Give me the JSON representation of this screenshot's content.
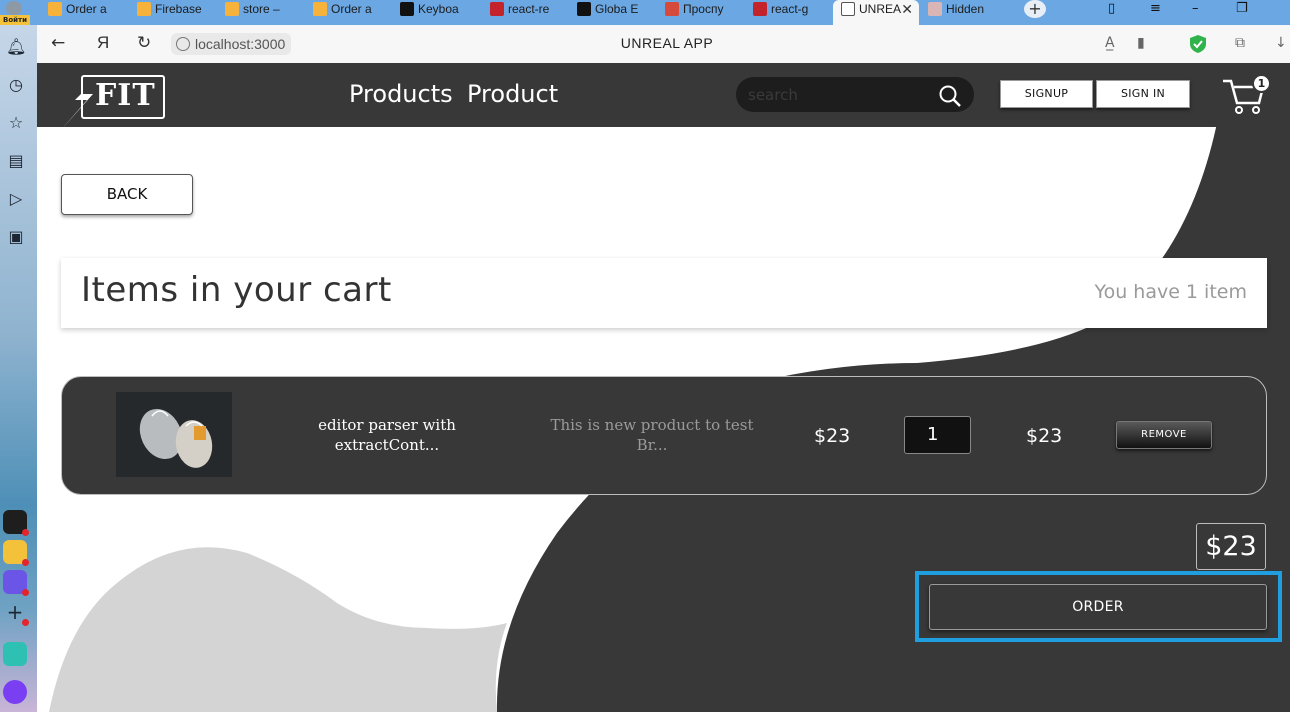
{
  "browser": {
    "profile_label": "Войти",
    "tabs": [
      {
        "label": "Order a",
        "color": "#f6b23b"
      },
      {
        "label": "Firebase",
        "color": "#f6b23b"
      },
      {
        "label": "store – ",
        "color": "#f6b23b"
      },
      {
        "label": "Order a",
        "color": "#f6b23b"
      },
      {
        "label": "Keyboa",
        "color": "#111111"
      },
      {
        "label": "react-re",
        "color": "#c3242b"
      },
      {
        "label": "Globa E",
        "color": "#111111"
      },
      {
        "label": "Проспу",
        "color": "#d64a3b"
      },
      {
        "label": "react-g",
        "color": "#c3242b"
      },
      {
        "label": "UNREA",
        "color": "#ffffff"
      },
      {
        "label": "Hidden",
        "color": "#d9b5b5"
      }
    ],
    "active_tab_close": "✕",
    "new_tab": "+",
    "url": "localhost:3000",
    "page_title": "UNREAL APP"
  },
  "site": {
    "logo_text": "FIT",
    "nav": [
      "Products",
      "Product"
    ],
    "search_placeholder": "search",
    "signup_label": "SIGNUP",
    "signin_label": "SIGN IN",
    "cart_count": "1",
    "back_label": "BACK",
    "cart_title": "Items in your cart",
    "cart_summary": "You have 1 item",
    "item": {
      "name": "editor parser with extractCont...",
      "description": "This is new product to test Br...",
      "price": "$23",
      "quantity": "1",
      "total": "$23",
      "remove_label": "REMOVE"
    },
    "grand_total": "$23",
    "order_label": "ORDER"
  },
  "colors": {
    "header_bg": "#383838",
    "highlight": "#1f9ee0",
    "light_shape": "#d4d4d4"
  }
}
